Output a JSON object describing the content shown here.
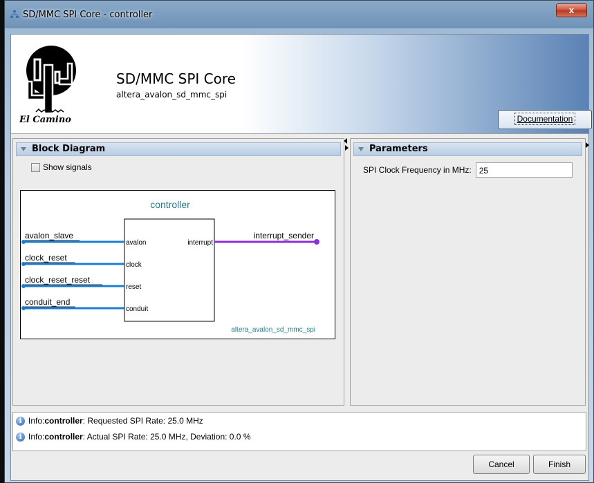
{
  "window": {
    "title": "SD/MMC SPI Core - controller",
    "close_label": "x"
  },
  "header": {
    "logo_text": "El Camino",
    "core_name": "SD/MMC SPI Core",
    "core_id": "altera_avalon_sd_mmc_spi",
    "documentation_label": "Documentation"
  },
  "block_diagram": {
    "panel_title": "Block Diagram",
    "show_signals_label": "Show signals",
    "show_signals_checked": false,
    "instance_name": "controller",
    "component_name": "altera_avalon_sd_mmc_spi",
    "left_interfaces": [
      {
        "external": "avalon_slave",
        "port": "avalon"
      },
      {
        "external": "clock_reset",
        "port": "clock"
      },
      {
        "external": "clock_reset_reset",
        "port": "reset"
      },
      {
        "external": "conduit_end",
        "port": "conduit"
      }
    ],
    "right_interfaces": [
      {
        "external": "interrupt_sender",
        "port": "interrupt"
      }
    ],
    "colors": {
      "left_wire": "#1a7fd4",
      "right_wire": "#8b2fd9",
      "title": "#1e7f8c"
    }
  },
  "parameters": {
    "panel_title": "Parameters",
    "spi_clock_label": "SPI Clock Frequency in MHz:",
    "spi_clock_value": "25"
  },
  "messages": [
    {
      "prefix": "Info: ",
      "source": "controller",
      "text": ": Requested SPI Rate: 25.0 MHz"
    },
    {
      "prefix": "Info: ",
      "source": "controller",
      "text": ": Actual SPI Rate: 25.0 MHz, Deviation: 0.0 %"
    }
  ],
  "buttons": {
    "cancel": "Cancel",
    "finish": "Finish"
  }
}
